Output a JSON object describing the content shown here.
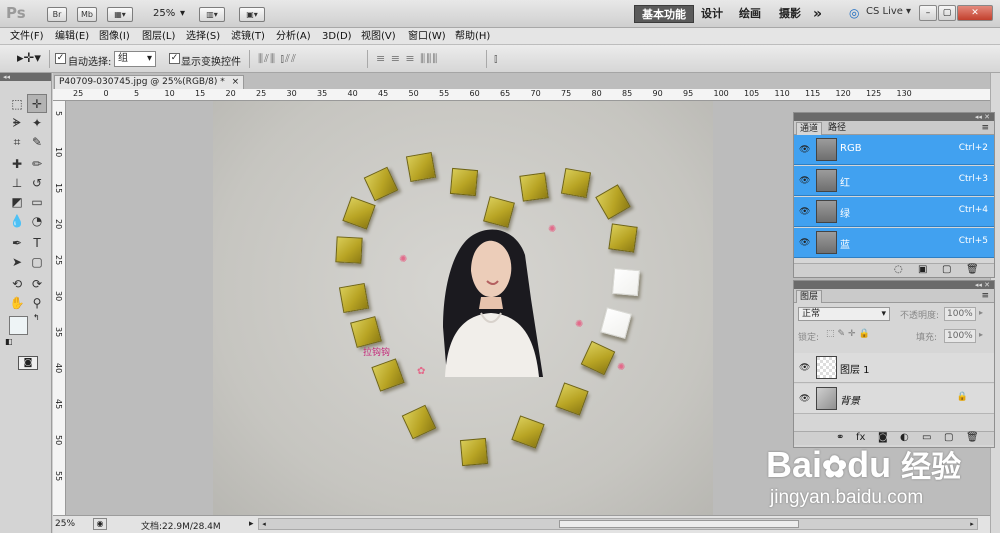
{
  "app": {
    "logo": "Ps",
    "top_buttons": [
      "Br",
      "Mb"
    ],
    "zoom": "25%",
    "workspaces": [
      "基本功能",
      "设计",
      "绘画",
      "摄影"
    ],
    "more": "»",
    "cs_live": "CS Live",
    "window_controls": [
      "–",
      "▢",
      "✕"
    ]
  },
  "menu": [
    "文件(F)",
    "编辑(E)",
    "图像(I)",
    "图层(L)",
    "选择(S)",
    "滤镜(T)",
    "分析(A)",
    "3D(D)",
    "视图(V)",
    "窗口(W)",
    "帮助(H)"
  ],
  "options": {
    "auto_select_label": "自动选择:",
    "auto_select_value": "组",
    "show_transform_label": "显示变换控件",
    "align_group1": "⫼⫽⫼ ⫾⫽⫽",
    "align_group2": "≡ ≡ ≡ ⫼⫼⫼",
    "align_group3": "⫾"
  },
  "document": {
    "tab_title": "P40709-030745.jpg @ 25%(RGB/8) *",
    "tab_close": "×",
    "watermark_text": "拉钩钩",
    "ruler_h": [
      "25",
      "0",
      "5",
      "10",
      "15",
      "20",
      "25",
      "30",
      "35",
      "40",
      "45",
      "50",
      "55",
      "60",
      "65",
      "70",
      "75",
      "80",
      "85",
      "90",
      "95",
      "100",
      "105",
      "110",
      "115",
      "120",
      "125",
      "130"
    ],
    "ruler_v": [
      "5",
      "10",
      "15",
      "20",
      "25",
      "30",
      "35",
      "40",
      "45",
      "50",
      "55"
    ]
  },
  "status": {
    "zoom": "25%",
    "doc_info": "文档:22.9M/28.4M"
  },
  "channels_panel": {
    "tabs": [
      "通道",
      "路径"
    ],
    "rows": [
      {
        "name": "RGB",
        "shortcut": "Ctrl+2"
      },
      {
        "name": "红",
        "shortcut": "Ctrl+3"
      },
      {
        "name": "绿",
        "shortcut": "Ctrl+4"
      },
      {
        "name": "蓝",
        "shortcut": "Ctrl+5"
      }
    ],
    "highlight_color": "#41a1f0"
  },
  "layers_panel": {
    "tab": "图层",
    "blend_mode": "正常",
    "opacity_label": "不透明度:",
    "opacity_value": "100%",
    "lock_label": "锁定:",
    "fill_label": "填充:",
    "fill_value": "100%",
    "layers": [
      {
        "name": "图层 1"
      },
      {
        "name": "背景"
      }
    ]
  },
  "baidu_watermark": {
    "brand": "Bai",
    "brand2": "du",
    "chinese": "经验",
    "url": "jingyan.baidu.com"
  }
}
